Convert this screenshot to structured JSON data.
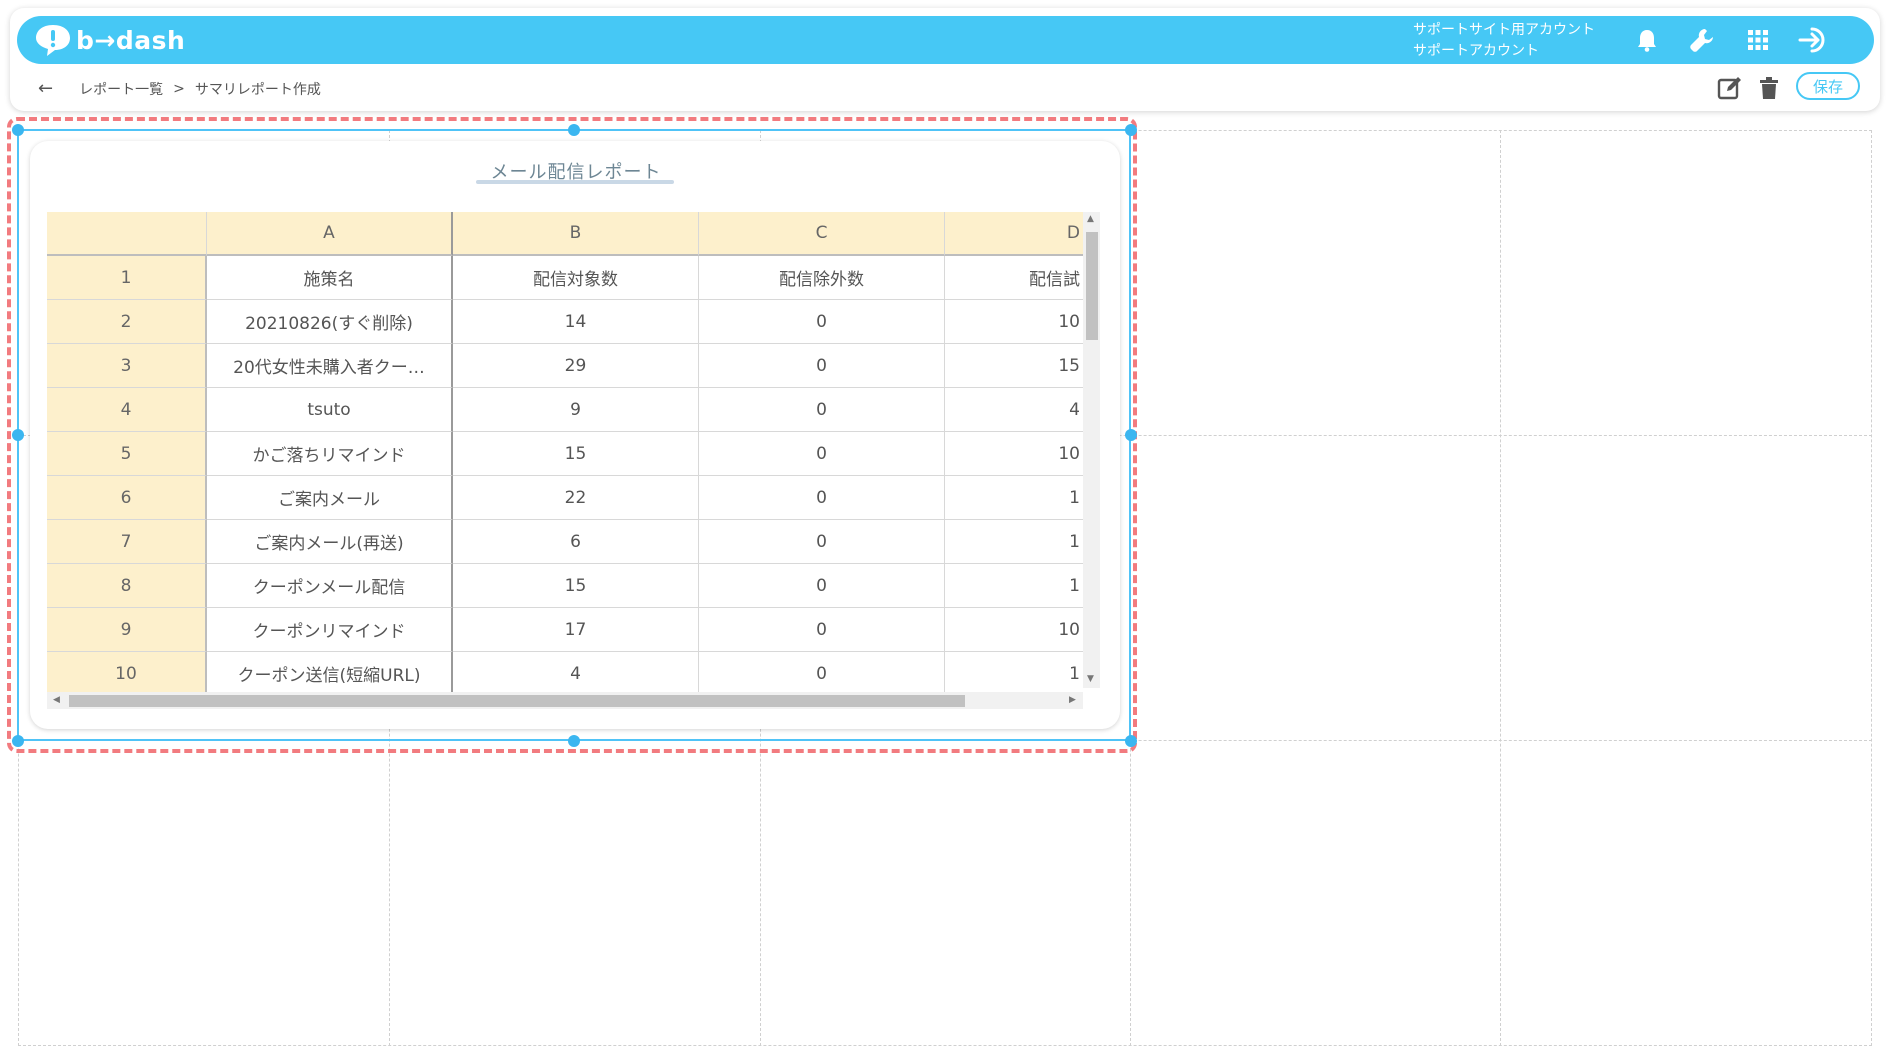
{
  "app": {
    "logo_text": "b→dash"
  },
  "account": {
    "line1": "サポートサイト用アカウント",
    "line2": "サポートアカウント"
  },
  "topbar_icons": [
    "bell-icon",
    "wrench-icon",
    "grid-apps-icon",
    "logout-icon"
  ],
  "breadcrumb": {
    "back": "←",
    "parent": "レポート一覧",
    "separator": ">",
    "current": "サマリレポート作成"
  },
  "toolbar": {
    "save_label": "保存"
  },
  "colors": {
    "accent": "#46c8f5",
    "selection_dashed": "#f27b7f",
    "header_fill": "#fdf0cc"
  },
  "widget": {
    "title": "メール配信レポート",
    "column_letters": [
      "",
      "A",
      "B",
      "C",
      "D"
    ],
    "rows": [
      [
        "1",
        "施策名",
        "配信対象数",
        "配信除外数",
        "配信試"
      ],
      [
        "2",
        "20210826(すぐ削除)",
        "14",
        "0",
        "10"
      ],
      [
        "3",
        "20代女性未購入者クー…",
        "29",
        "0",
        "15"
      ],
      [
        "4",
        "tsuto",
        "9",
        "0",
        "4"
      ],
      [
        "5",
        "かご落ちリマインド",
        "15",
        "0",
        "10"
      ],
      [
        "6",
        "ご案内メール",
        "22",
        "0",
        "1"
      ],
      [
        "7",
        "ご案内メール(再送)",
        "6",
        "0",
        "1"
      ],
      [
        "8",
        "クーポンメール配信",
        "15",
        "0",
        "1"
      ],
      [
        "9",
        "クーポンリマインド",
        "17",
        "0",
        "10"
      ],
      [
        "10",
        "クーポン送信(短縮URL)",
        "4",
        "0",
        "1"
      ]
    ]
  }
}
